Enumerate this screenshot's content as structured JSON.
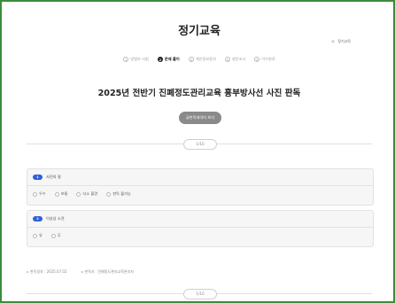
{
  "header": {
    "title": "정기교육",
    "home_label": "정기교육"
  },
  "steps": [
    {
      "num": "1",
      "label": "방법보 시험",
      "active": false
    },
    {
      "num": "2",
      "label": "문제 풀이",
      "active": true
    },
    {
      "num": "3",
      "label": "개인정보동의",
      "active": false
    },
    {
      "num": "4",
      "label": "설문조사",
      "active": false
    },
    {
      "num": "5",
      "label": "이수완료",
      "active": false
    }
  ],
  "subject": "2025년 전반기 진폐정도관리교육 흉부방사선 사진 판독",
  "preview_button": "글판독데이미 보기",
  "pager_top": "1/10",
  "pager_bottom": "1/10",
  "questions": [
    {
      "num": "1",
      "text": "사진의 질",
      "options": [
        "우수",
        "보통",
        "다소 불량",
        "판독 불가능"
      ]
    },
    {
      "num": "2",
      "text": "이상상 소견",
      "options": [
        "유",
        "무"
      ]
    }
  ],
  "meta": {
    "date_label": "판독일자 : 2025.07.02",
    "reader_label": "판독자 : 진폐정도관리교육관리자"
  }
}
